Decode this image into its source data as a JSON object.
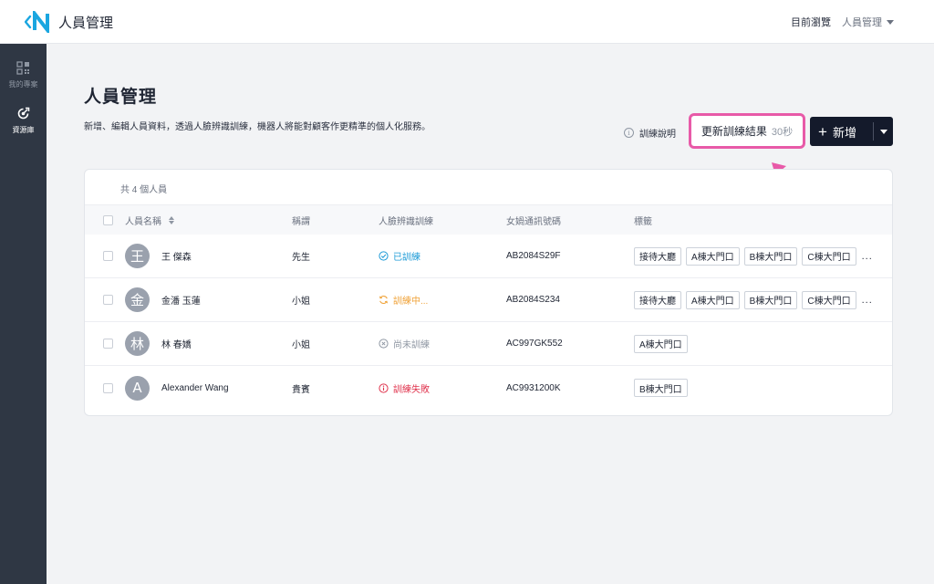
{
  "header": {
    "app_title": "人員管理",
    "viewing_label": "目前瀏覽",
    "dept_label": "人員管理"
  },
  "sidebar": {
    "items": [
      {
        "label": "我的專案",
        "icon": "grid-icon",
        "active": false
      },
      {
        "label": "資源庫",
        "icon": "resource-icon",
        "active": true
      }
    ]
  },
  "main": {
    "title": "人員管理",
    "description": "新增、編輯人員資料，透過人臉辨識訓練，機器人將能對顧客作更精準的個人化服務。",
    "help_label": "訓練說明",
    "refresh_label": "更新訓練結果",
    "refresh_seconds": "30秒",
    "add_label": "新增"
  },
  "table": {
    "count_label": "共 4 個人員",
    "headers": {
      "name": "人員名稱",
      "title": "稱謂",
      "face": "人臉辨識訓練",
      "serial": "女媧通訊號碼",
      "tags": "標籤"
    },
    "rows": [
      {
        "avatar": "王",
        "name": "王 傑森",
        "title": "先生",
        "status": "已訓練",
        "status_type": "trained",
        "serial": "AB2084S29F",
        "tags": [
          "接待大廳",
          "A棟大門口",
          "B棟大門口",
          "C棟大門口"
        ],
        "more": "..."
      },
      {
        "avatar": "金",
        "name": "金潘 玉蓮",
        "title": "小姐",
        "status": "訓練中...",
        "status_type": "training",
        "serial": "AB2084S234",
        "tags": [
          "接待大廳",
          "A棟大門口",
          "B棟大門口",
          "C棟大門口"
        ],
        "more": "..."
      },
      {
        "avatar": "林",
        "name": "林 春嬌",
        "title": "小姐",
        "status": "尚未訓練",
        "status_type": "untrained",
        "serial": "AC997GK552",
        "tags": [
          "A棟大門口"
        ],
        "more": ""
      },
      {
        "avatar": "A",
        "name": "Alexander Wang",
        "title": "貴賓",
        "status": "訓練失敗",
        "status_type": "failed",
        "serial": "AC9931200K",
        "tags": [
          "B棟大門口"
        ],
        "more": ""
      }
    ]
  },
  "colors": {
    "accent_highlight": "#e85aa8",
    "primary_dark": "#141a2b",
    "sidebar_bg": "#2f3744",
    "trained": "#1e9bd7",
    "training": "#f0a33a",
    "untrained": "#8f97a3",
    "failed": "#e0344e"
  }
}
